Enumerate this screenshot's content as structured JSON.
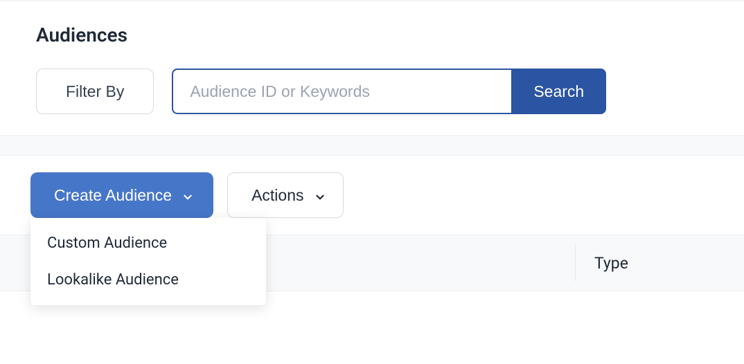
{
  "page": {
    "title": "Audiences"
  },
  "filter": {
    "filter_by_label": "Filter By",
    "search_placeholder": "Audience ID or Keywords",
    "search_button": "Search"
  },
  "actions": {
    "create_audience_label": "Create Audience",
    "actions_label": "Actions",
    "dropdown": {
      "items": [
        {
          "label": "Custom Audience"
        },
        {
          "label": "Lookalike Audience"
        }
      ]
    }
  },
  "table": {
    "columns": {
      "type": "Type"
    }
  },
  "colors": {
    "primary_dark": "#2b55a2",
    "primary": "#4676c8"
  }
}
